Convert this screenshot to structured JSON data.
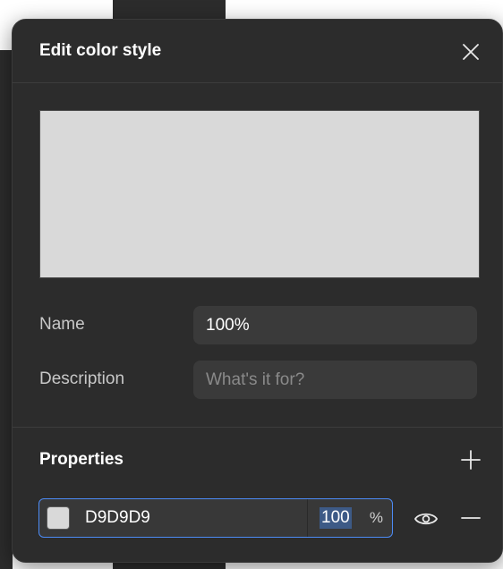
{
  "dialog": {
    "title": "Edit color style",
    "preview_color": "#D9D9D9"
  },
  "name_field": {
    "label": "Name",
    "value": "100%"
  },
  "description_field": {
    "label": "Description",
    "placeholder": "What's it for?"
  },
  "properties": {
    "title": "Properties",
    "items": [
      {
        "hex": "D9D9D9",
        "opacity": "100",
        "unit": "%"
      }
    ]
  },
  "icons": {
    "close": "close-icon",
    "add": "plus-icon",
    "visibility": "eye-icon",
    "remove": "minus-icon"
  },
  "colors": {
    "accent": "#4C8BF5",
    "panel": "#2C2C2C",
    "input": "#3A3A3A"
  }
}
